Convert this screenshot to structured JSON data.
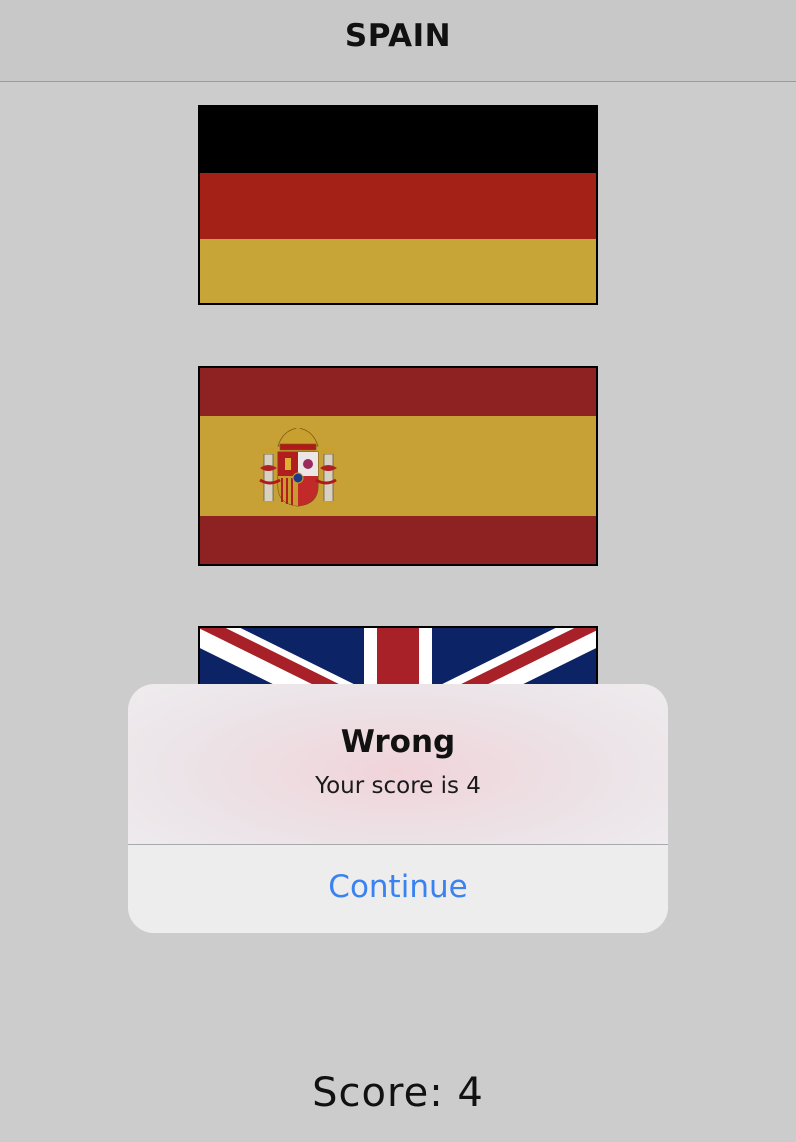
{
  "navbar": {
    "title": "SPAIN"
  },
  "flags": [
    {
      "name": "Germany",
      "colors": [
        "#000000",
        "#a32117",
        "#c7a536"
      ]
    },
    {
      "name": "Spain",
      "colors": [
        "#8e2121",
        "#c7a136",
        "#8e2121"
      ]
    },
    {
      "name": "United Kingdom",
      "colors": [
        "#0c2466",
        "#ffffff",
        "#a82128"
      ]
    }
  ],
  "alert": {
    "title": "Wrong",
    "message": "Your score is 4",
    "button_label": "Continue",
    "button_color": "#3a82f0"
  },
  "footer": {
    "score_text": "Score: 4"
  }
}
